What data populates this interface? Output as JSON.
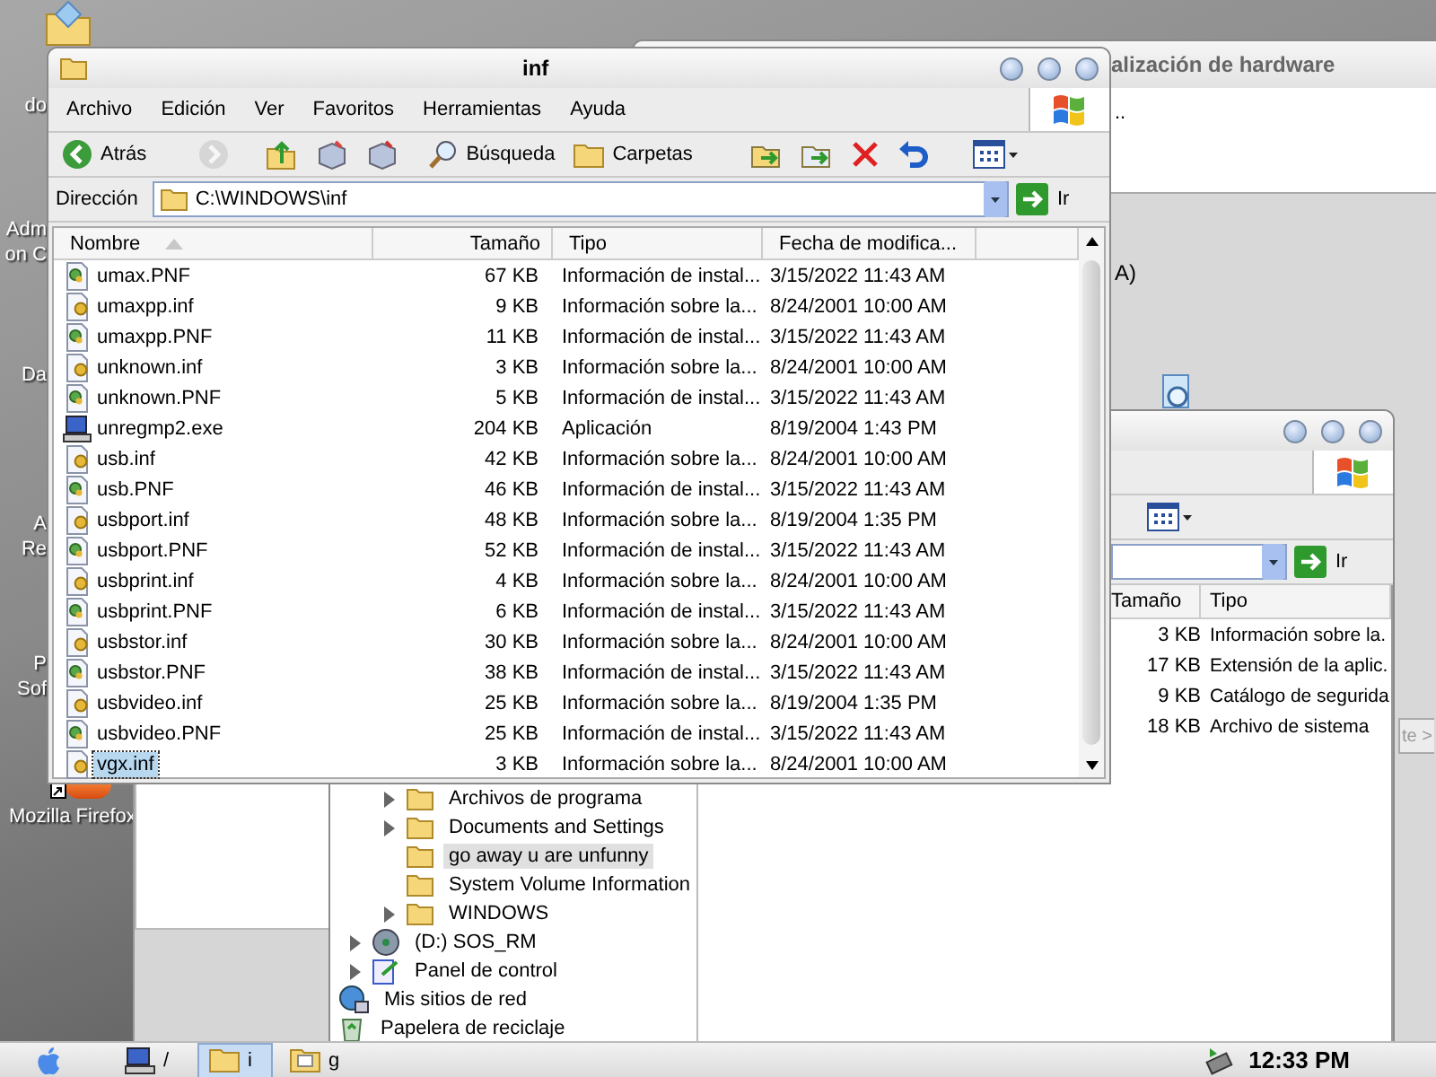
{
  "desktop": {
    "icon_labels": [
      {
        "lines": [
          "do"
        ]
      },
      {
        "lines": [
          "Adm",
          "on C"
        ]
      },
      {
        "lines": [
          "Da"
        ]
      },
      {
        "lines": [
          "A",
          "Re"
        ]
      },
      {
        "lines": [
          "P",
          "Sof"
        ]
      }
    ],
    "firefox_label": "Mozilla Firefox"
  },
  "wizard_window": {
    "title": "alización de hardware",
    "line_1": "..",
    "line_2": "A)",
    "next_button": "te >"
  },
  "second_explorer": {
    "go_button": "Ir",
    "columns": [
      "Tamaño",
      "Tipo"
    ],
    "rows": [
      {
        "size": "3 KB",
        "type": "Información sobre la."
      },
      {
        "size": "17 KB",
        "type": "Extensión de la aplic."
      },
      {
        "size": "9 KB",
        "type": "Catálogo de segurida"
      },
      {
        "size": "18 KB",
        "type": "Archivo de sistema"
      }
    ],
    "tree": {
      "partial_branch": [
        {
          "label": "Archivos de programa",
          "expandable": true,
          "selected": false
        },
        {
          "label": "Documents and Settings",
          "expandable": true,
          "selected": false
        },
        {
          "label": "go away u are unfunny",
          "expandable": false,
          "selected": true
        },
        {
          "label": "System Volume Information",
          "expandable": false,
          "selected": false
        },
        {
          "label": "WINDOWS",
          "expandable": true,
          "selected": false
        }
      ],
      "items": [
        {
          "kind": "drive",
          "label": "(D:) SOS_RM",
          "expandable": true
        },
        {
          "kind": "control-panel",
          "label": "Panel de control",
          "expandable": true
        },
        {
          "kind": "network",
          "label": "Mis sitios de red",
          "expandable": false
        },
        {
          "kind": "recycle-bin",
          "label": "Papelera de reciclaje",
          "expandable": false
        }
      ]
    }
  },
  "main_window": {
    "title": "inf",
    "menu": [
      "Archivo",
      "Edición",
      "Ver",
      "Favoritos",
      "Herramientas",
      "Ayuda"
    ],
    "toolbar": [
      {
        "kind": "back",
        "label": "Atrás",
        "disabled": false
      },
      {
        "kind": "forward",
        "disabled": true
      },
      {
        "kind": "up",
        "disabled": false
      },
      {
        "kind": "move",
        "disabled": false
      },
      {
        "kind": "copy",
        "disabled": false
      },
      {
        "kind": "search",
        "label": "Búsqueda",
        "disabled": false
      },
      {
        "kind": "folders",
        "label": "Carpetas",
        "disabled": false
      },
      {
        "kind": "move-to",
        "disabled": false
      },
      {
        "kind": "copy-to",
        "disabled": false
      },
      {
        "kind": "delete",
        "disabled": false
      },
      {
        "kind": "undo",
        "disabled": false
      },
      {
        "kind": "views",
        "disabled": false
      }
    ],
    "address": {
      "label": "Dirección",
      "value": "C:\\WINDOWS\\inf",
      "go_button": "Ir"
    },
    "columns": [
      "Nombre",
      "Tamaño",
      "Tipo",
      "Fecha de modifica..."
    ],
    "rows": [
      {
        "kind": "pnf",
        "name": "umax.PNF",
        "size": "67 KB",
        "type": "Información de instal...",
        "date": "3/15/2022 11:43 AM",
        "selected": false
      },
      {
        "kind": "inf",
        "name": "umaxpp.inf",
        "size": "9 KB",
        "type": "Información sobre la...",
        "date": "8/24/2001 10:00 AM",
        "selected": false
      },
      {
        "kind": "pnf",
        "name": "umaxpp.PNF",
        "size": "11 KB",
        "type": "Información de instal...",
        "date": "3/15/2022 11:43 AM",
        "selected": false
      },
      {
        "kind": "inf",
        "name": "unknown.inf",
        "size": "3 KB",
        "type": "Información sobre la...",
        "date": "8/24/2001 10:00 AM",
        "selected": false
      },
      {
        "kind": "pnf",
        "name": "unknown.PNF",
        "size": "5 KB",
        "type": "Información de instal...",
        "date": "3/15/2022 11:43 AM",
        "selected": false
      },
      {
        "kind": "exe",
        "name": "unregmp2.exe",
        "size": "204 KB",
        "type": "Aplicación",
        "date": "8/19/2004 1:43 PM",
        "selected": false
      },
      {
        "kind": "inf",
        "name": "usb.inf",
        "size": "42 KB",
        "type": "Información sobre la...",
        "date": "8/24/2001 10:00 AM",
        "selected": false
      },
      {
        "kind": "pnf",
        "name": "usb.PNF",
        "size": "46 KB",
        "type": "Información de instal...",
        "date": "3/15/2022 11:43 AM",
        "selected": false
      },
      {
        "kind": "inf",
        "name": "usbport.inf",
        "size": "48 KB",
        "type": "Información sobre la...",
        "date": "8/19/2004 1:35 PM",
        "selected": false
      },
      {
        "kind": "pnf",
        "name": "usbport.PNF",
        "size": "52 KB",
        "type": "Información de instal...",
        "date": "3/15/2022 11:43 AM",
        "selected": false
      },
      {
        "kind": "inf",
        "name": "usbprint.inf",
        "size": "4 KB",
        "type": "Información sobre la...",
        "date": "8/24/2001 10:00 AM",
        "selected": false
      },
      {
        "kind": "pnf",
        "name": "usbprint.PNF",
        "size": "6 KB",
        "type": "Información de instal...",
        "date": "3/15/2022 11:43 AM",
        "selected": false
      },
      {
        "kind": "inf",
        "name": "usbstor.inf",
        "size": "30 KB",
        "type": "Información sobre la...",
        "date": "8/24/2001 10:00 AM",
        "selected": false
      },
      {
        "kind": "pnf",
        "name": "usbstor.PNF",
        "size": "38 KB",
        "type": "Información de instal...",
        "date": "3/15/2022 11:43 AM",
        "selected": false
      },
      {
        "kind": "inf",
        "name": "usbvideo.inf",
        "size": "25 KB",
        "type": "Información sobre la...",
        "date": "8/19/2004 1:35 PM",
        "selected": false
      },
      {
        "kind": "pnf",
        "name": "usbvideo.PNF",
        "size": "25 KB",
        "type": "Información de instal...",
        "date": "3/15/2022 11:43 AM",
        "selected": false
      },
      {
        "kind": "inf",
        "name": "vgx.inf",
        "size": "3 KB",
        "type": "Información sobre la...",
        "date": "8/24/2001 10:00 AM",
        "selected": true
      }
    ]
  },
  "taskbar": {
    "buttons": [
      {
        "kind": "computer",
        "label": "/",
        "selected": false
      },
      {
        "kind": "folder",
        "label": "i",
        "selected": true
      },
      {
        "kind": "folder-files",
        "label": "g",
        "selected": false
      }
    ],
    "clock": "12:33 PM"
  }
}
